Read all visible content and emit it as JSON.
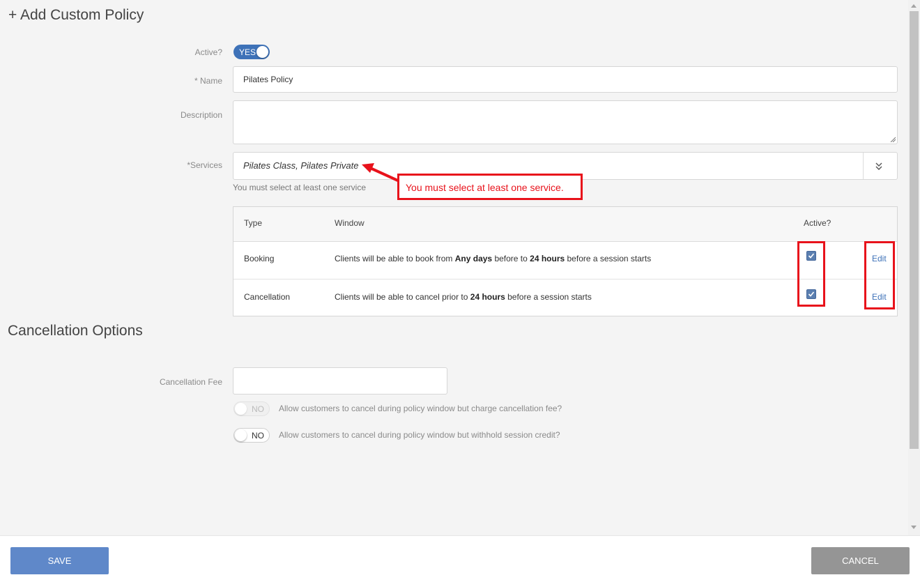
{
  "page": {
    "title": "+ Add Custom Policy"
  },
  "form": {
    "active_label": "Active?",
    "active_toggle": "YES",
    "name_label": "* Name",
    "name_value": "Pilates Policy",
    "description_label": "Description",
    "description_value": "",
    "services_label": "*Services",
    "services_value": "Pilates Class, Pilates Private",
    "services_helper": "You must select at least one service"
  },
  "callout": {
    "text": "You must select at least one service."
  },
  "policy_table": {
    "headers": [
      "Type",
      "Window",
      "Active?"
    ],
    "rows": [
      {
        "type": "Booking",
        "window_prefix": "Clients will be able to book from ",
        "window_bold1": "Any days",
        "window_mid": " before to ",
        "window_bold2": "24 hours",
        "window_suffix": " before a session starts",
        "active": true,
        "edit": "Edit"
      },
      {
        "type": "Cancellation",
        "window_prefix": "Clients will be able to cancel prior to ",
        "window_bold1": "24 hours",
        "window_suffix": " before a session starts",
        "active": true,
        "edit": "Edit"
      }
    ]
  },
  "cancellation": {
    "title": "Cancellation Options",
    "fee_label": "Cancellation Fee",
    "fee_value": "",
    "option1_toggle": "NO",
    "option1_text": "Allow customers to cancel during policy window but charge cancellation fee?",
    "option2_toggle": "NO",
    "option2_text": "Allow customers to cancel during policy window but withhold session credit?"
  },
  "footer": {
    "save": "SAVE",
    "cancel": "CANCEL"
  },
  "colors": {
    "accent": "#3e72b8",
    "highlight": "#e8121b",
    "save_button": "#5f88c9",
    "cancel_button": "#959595"
  }
}
